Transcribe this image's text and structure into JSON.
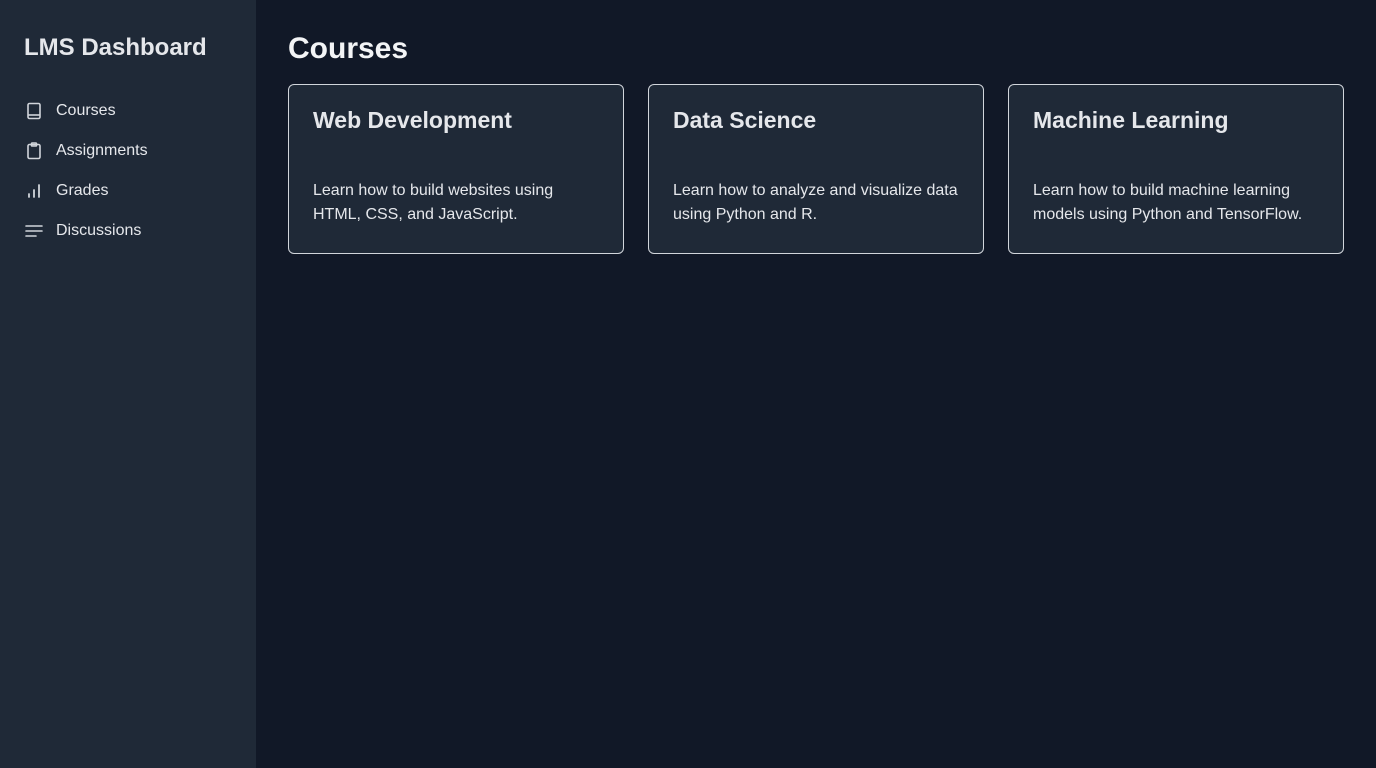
{
  "sidebar": {
    "brand": "LMS Dashboard",
    "items": [
      {
        "label": "Courses",
        "icon": "book-icon"
      },
      {
        "label": "Assignments",
        "icon": "clipboard-icon"
      },
      {
        "label": "Grades",
        "icon": "bar-chart-icon"
      },
      {
        "label": "Discussions",
        "icon": "list-icon"
      }
    ]
  },
  "main": {
    "title": "Courses",
    "courses": [
      {
        "title": "Web Development",
        "description": "Learn how to build websites using HTML, CSS, and JavaScript."
      },
      {
        "title": "Data Science",
        "description": "Learn how to analyze and visualize data using Python and R."
      },
      {
        "title": "Machine Learning",
        "description": "Learn how to build machine learning models using Python and TensorFlow."
      }
    ]
  },
  "colors": {
    "sidebar_bg": "#1f2937",
    "main_bg": "#111827",
    "card_bg": "#1f2937",
    "card_border": "#d1d5db",
    "text": "#e5e7eb"
  }
}
